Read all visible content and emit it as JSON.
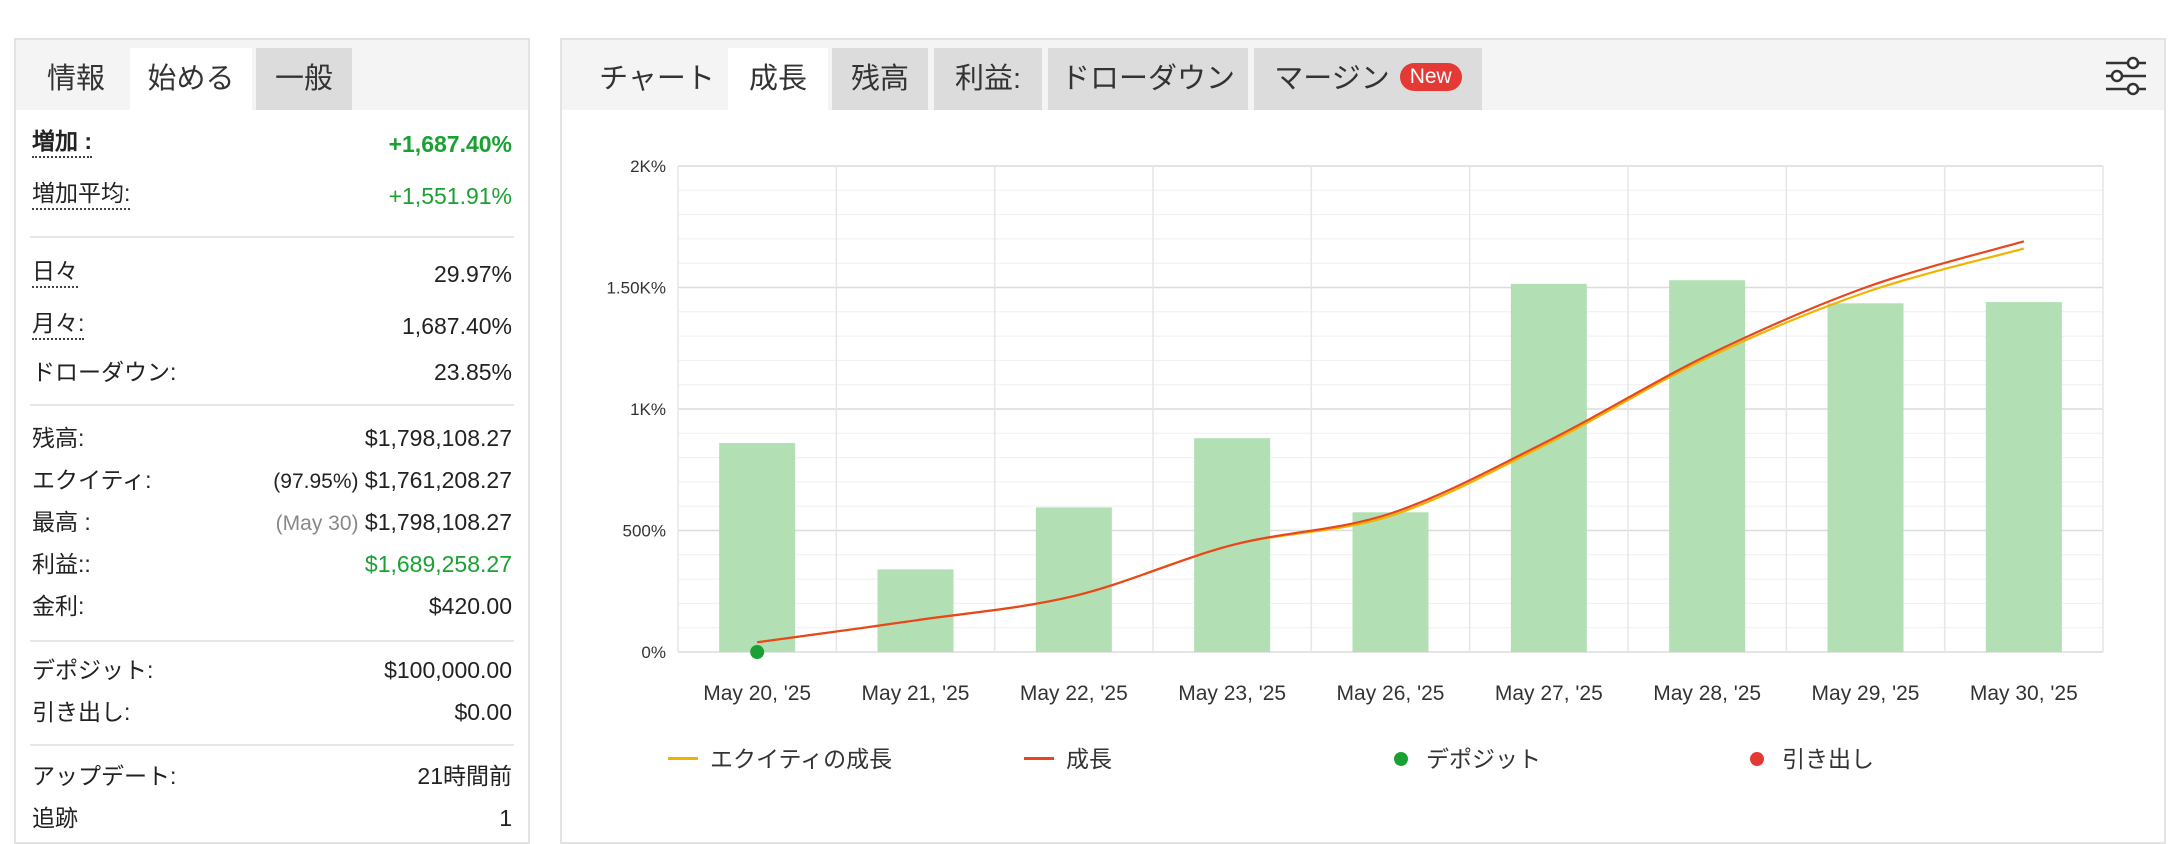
{
  "left": {
    "tabs": [
      {
        "label": "情報"
      },
      {
        "label": "始める"
      },
      {
        "label": "一般"
      }
    ],
    "stats": {
      "gain": {
        "label": "増加 :",
        "value": "+1,687.40%"
      },
      "avg_gain": {
        "label": "増加平均:",
        "value": "+1,551.91%"
      },
      "daily": {
        "label": "日々",
        "value": "29.97%"
      },
      "monthly": {
        "label": "月々:",
        "value": "1,687.40%"
      },
      "drawdown": {
        "label": "ドローダウン:",
        "value": "23.85%"
      },
      "balance": {
        "label": "残高:",
        "value": "$1,798,108.27"
      },
      "equity": {
        "label": "エクイティ:",
        "note": "(97.95%)",
        "value": "$1,761,208.27"
      },
      "highest": {
        "label": "最高 :",
        "note": "(May 30)",
        "value": "$1,798,108.27"
      },
      "profit": {
        "label": "利益::",
        "value": "$1,689,258.27"
      },
      "interest": {
        "label": "金利:",
        "value": "$420.00"
      },
      "deposits": {
        "label": "デポジット:",
        "value": "$100,000.00"
      },
      "withdrawals": {
        "label": "引き出し:",
        "value": "$0.00"
      },
      "updated": {
        "label": "アップデート:",
        "value": "21時間前"
      },
      "tracking": {
        "label": "追跡",
        "value": "1"
      }
    }
  },
  "right": {
    "tabs": [
      {
        "label": "チャート"
      },
      {
        "label": "成長"
      },
      {
        "label": "残高"
      },
      {
        "label": "利益:"
      },
      {
        "label": "ドローダウン"
      },
      {
        "label": "マージン",
        "badge": "New"
      }
    ],
    "settings_icon": "sliders-icon"
  },
  "colors": {
    "green": "#1aa033",
    "bar": "#b3dfb5",
    "growth": "#e8461f",
    "equity": "#f0b400",
    "deposit": "#1aa033",
    "withdrawal": "#e53935"
  },
  "chart_data": {
    "type": "bar",
    "categories": [
      "May 20, '25",
      "May 21, '25",
      "May 22, '25",
      "May 23, '25",
      "May 26, '25",
      "May 27, '25",
      "May 28, '25",
      "May 29, '25",
      "May 30, '25"
    ],
    "y_ticks": [
      "0%",
      "500%",
      "1K%",
      "1.50K%",
      "2K%"
    ],
    "ylim": [
      0,
      2000
    ],
    "grid": true,
    "legend_position": "bottom",
    "series": [
      {
        "type": "bar",
        "values": [
          860,
          340,
          595,
          880,
          575,
          1515,
          1530,
          1435,
          1440
        ]
      },
      {
        "name": "エクイティの成長",
        "type": "line",
        "values": [
          40,
          130,
          230,
          440,
          560,
          860,
          1210,
          1480,
          1660
        ]
      },
      {
        "name": "成長",
        "type": "line",
        "values": [
          40,
          130,
          230,
          440,
          570,
          870,
          1220,
          1500,
          1690
        ]
      },
      {
        "name": "デポジット",
        "type": "marker",
        "index": 0,
        "value": 0
      },
      {
        "name": "引き出し",
        "type": "marker"
      }
    ]
  }
}
